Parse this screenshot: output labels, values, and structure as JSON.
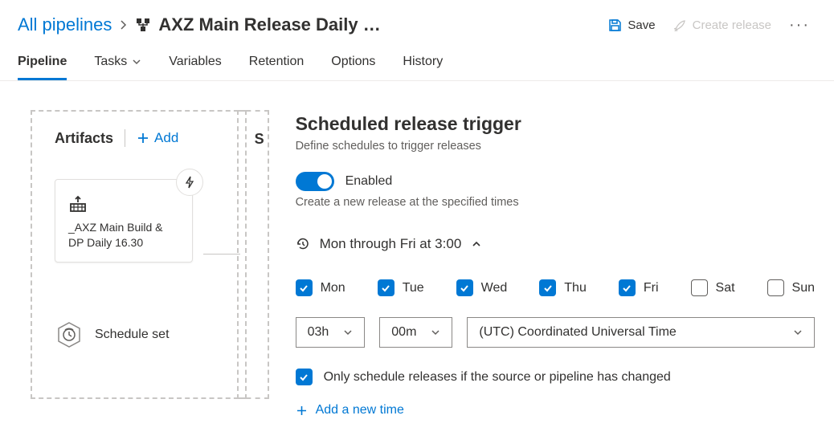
{
  "breadcrumb": {
    "root": "All pipelines",
    "title": "AXZ Main Release Daily  …"
  },
  "header_actions": {
    "save": "Save",
    "create_release": "Create release"
  },
  "tabs": {
    "pipeline": "Pipeline",
    "tasks": "Tasks",
    "variables": "Variables",
    "retention": "Retention",
    "options": "Options",
    "history": "History"
  },
  "artifacts": {
    "title": "Artifacts",
    "add": "Add",
    "card_name": "_AXZ Main Build & DP Daily 16.30",
    "schedule_set": "Schedule set",
    "stages_peek": "S"
  },
  "panel": {
    "title": "Scheduled release trigger",
    "subtitle": "Define schedules to trigger releases",
    "enabled_label": "Enabled",
    "enabled_desc": "Create a new release at the specified times",
    "summary": "Mon through Fri at 3:00",
    "days": {
      "mon": "Mon",
      "tue": "Tue",
      "wed": "Wed",
      "thu": "Thu",
      "fri": "Fri",
      "sat": "Sat",
      "sun": "Sun"
    },
    "hour": "03h",
    "minute": "00m",
    "timezone": "(UTC) Coordinated Universal Time",
    "only_if_changed": "Only schedule releases if the source or pipeline has changed",
    "add_time": "Add a new time"
  }
}
